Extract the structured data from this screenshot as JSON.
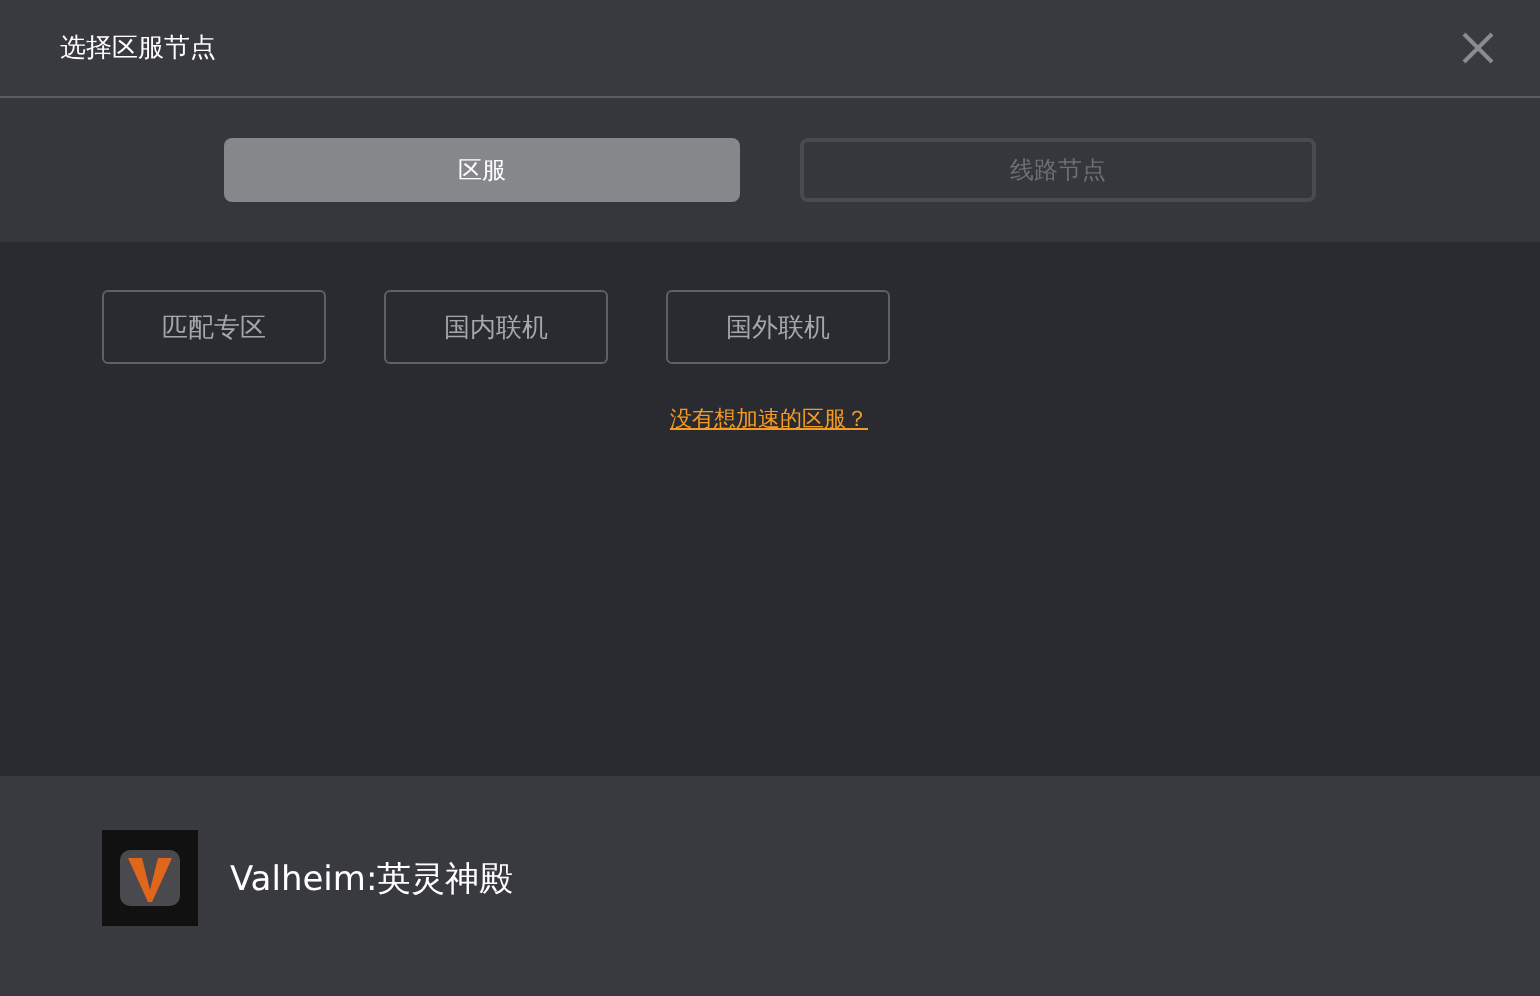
{
  "window": {
    "title": "选择区服节点"
  },
  "tabs": [
    {
      "label": "区服",
      "selected": true
    },
    {
      "label": "线路节点",
      "selected": false
    }
  ],
  "regions": [
    "匹配专区",
    "国内联机",
    "国外联机"
  ],
  "help_link": "没有想加速的区服？",
  "game": {
    "name": "Valheim:英灵神殿"
  }
}
